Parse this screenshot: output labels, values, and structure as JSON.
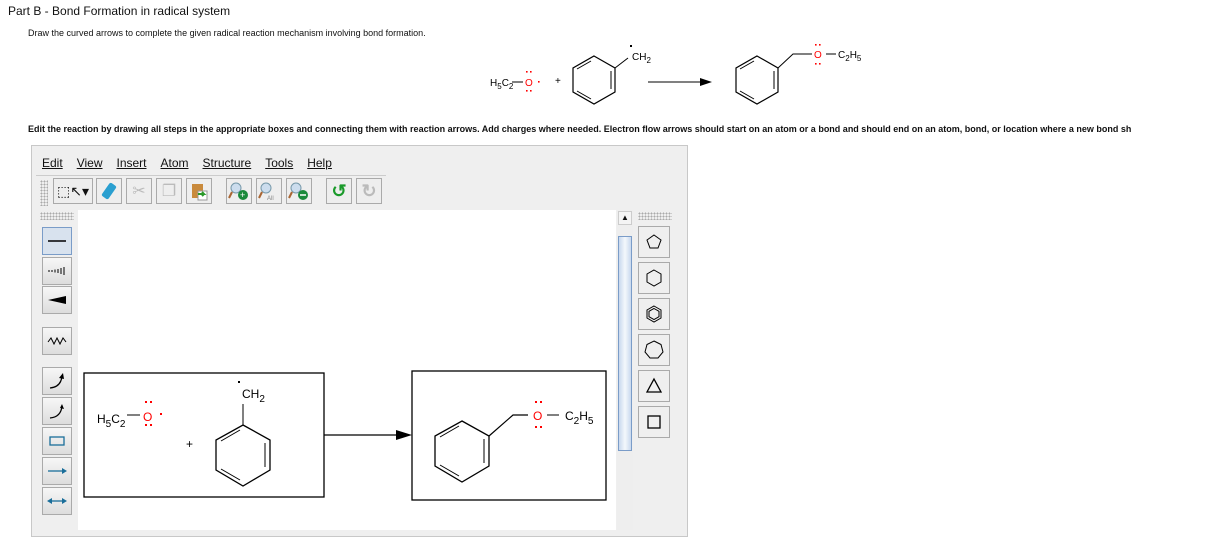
{
  "title": "Part B - Bond Formation in radical system",
  "instruction": "Draw the curved arrows to complete the given radical reaction mechanism involving bond formation.",
  "edit_instruction": "Edit the reaction by drawing all steps in the appropriate boxes and connecting them with reaction arrows. Add charges where needed. Electron flow arrows should start on an atom or a bond and should end on an atom, bond, or location where a new bond sh",
  "chem": {
    "H": "H",
    "C": "C",
    "O": "O",
    "n5": "5",
    "n2": "2",
    "plus": "+",
    "CH": "CH"
  },
  "menu": [
    "Edit",
    "View",
    "Insert",
    "Atom",
    "Structure",
    "Tools",
    "Help"
  ],
  "colors": {
    "oxygen": "#ff0000",
    "accent": "#1a6e9a"
  },
  "toolbar": [
    "select-tool",
    "eraser",
    "cut",
    "copy",
    "paste",
    "zoom-in",
    "zoom-all",
    "zoom-out",
    "undo",
    "redo"
  ],
  "left_tools": [
    "single-bond",
    "hashed-bond",
    "wedge-bond",
    "wavy-bond",
    "curved-arrow-two-electron",
    "curved-arrow-one-electron",
    "reaction-box",
    "reaction-arrow",
    "resonance-arrow"
  ],
  "templates": [
    "cyclopentane",
    "cyclohexane",
    "benzene",
    "cycloheptane",
    "cyclopropane",
    "cyclobutane"
  ],
  "zoom_all_label": "All"
}
